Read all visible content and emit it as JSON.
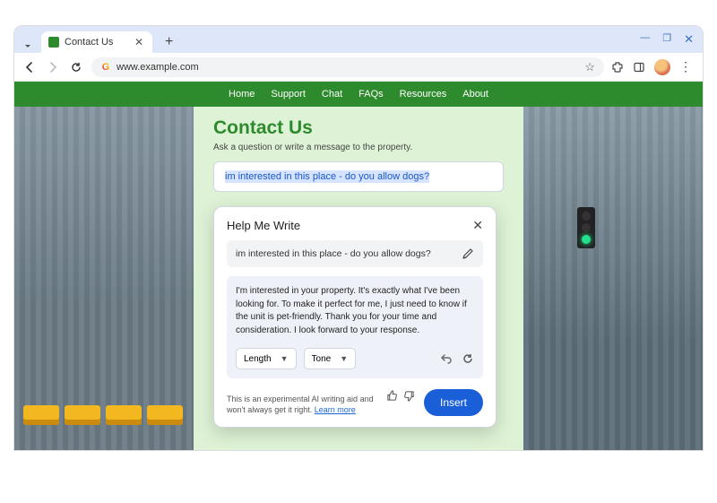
{
  "browser": {
    "tab_title": "Contact Us",
    "url": "www.example.com"
  },
  "site_nav": {
    "items": [
      {
        "label": "Home"
      },
      {
        "label": "Support"
      },
      {
        "label": "Chat"
      },
      {
        "label": "FAQs"
      },
      {
        "label": "Resources"
      },
      {
        "label": "About"
      }
    ]
  },
  "page": {
    "title": "Contact Us",
    "subtitle": "Ask a question or write a message to the property.",
    "question_text": "im interested in this place - do you allow dogs?"
  },
  "hmw": {
    "title": "Help Me Write",
    "input_text": "im interested in this place - do you allow dogs?",
    "output_text": "I'm interested in your property. It's exactly what I've been looking for. To make it perfect for me, I just need to know if the unit is pet-friendly. Thank you for your time and consideration. I look forward to your response.",
    "length_label": "Length",
    "tone_label": "Tone",
    "disclaimer_prefix": "This is an experimental AI writing aid and won't always get it right. ",
    "learn_more_label": "Learn more",
    "insert_label": "Insert"
  },
  "colors": {
    "brand_green": "#2d8a2d",
    "accent_blue": "#1a5ed8"
  }
}
